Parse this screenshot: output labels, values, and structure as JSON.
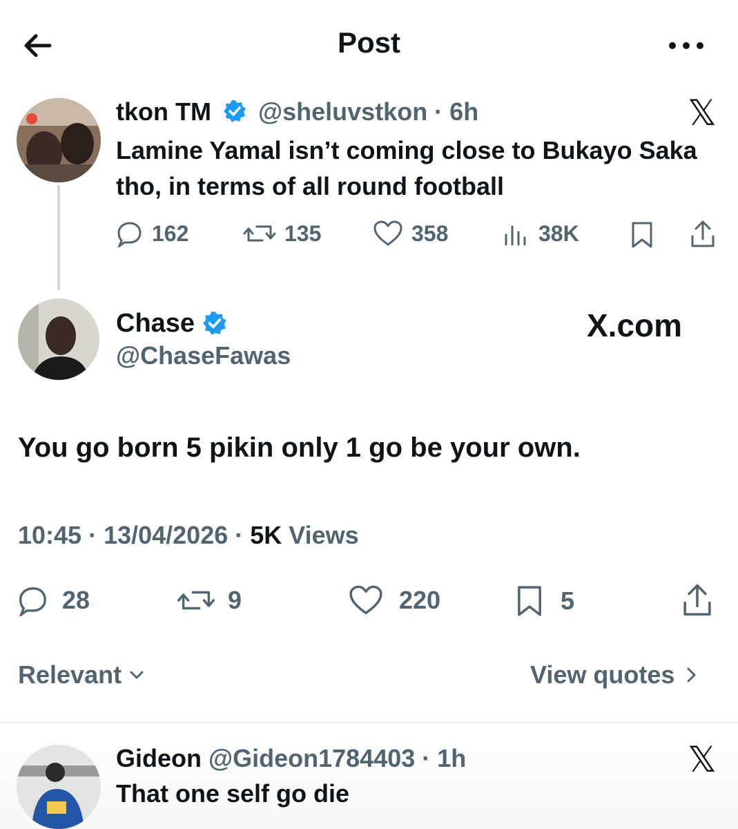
{
  "header": {
    "title": "Post"
  },
  "quoted": {
    "name": "tkon TM",
    "handle_time": "@sheluvstkon · 6h",
    "text": "Lamine Yamal isn’t coming close to Bukayo Saka tho, in terms of all round football",
    "stats": {
      "replies": "162",
      "reposts": "135",
      "likes": "358",
      "views": "38K"
    }
  },
  "post": {
    "name": "Chase",
    "handle": "@ChaseFawas",
    "watermark": "X.com",
    "text": "You go born 5 pikin only 1 go be your own.",
    "time_date": "10:45 · 13/04/2026 · ",
    "views_count": "5K",
    "views_label": "Views",
    "stats": {
      "replies": "28",
      "reposts": "9",
      "likes": "220",
      "bookmarks": "5"
    }
  },
  "controls": {
    "sort_label": "Relevant",
    "quotes_label": "View quotes"
  },
  "reply": {
    "name": "Gideon",
    "handle_time": "@Gideon1784403 · 1h",
    "text": "That one self go die"
  },
  "colors": {
    "verified": "#1d9bf0",
    "muted": "#536471",
    "text": "#0f1419"
  },
  "icons": [
    "back-arrow-icon",
    "more-icon",
    "verified-icon",
    "x-logo-icon",
    "reply-icon",
    "repost-icon",
    "like-icon",
    "views-icon",
    "bookmark-icon",
    "share-icon",
    "chevron-down-icon",
    "chevron-right-icon"
  ]
}
